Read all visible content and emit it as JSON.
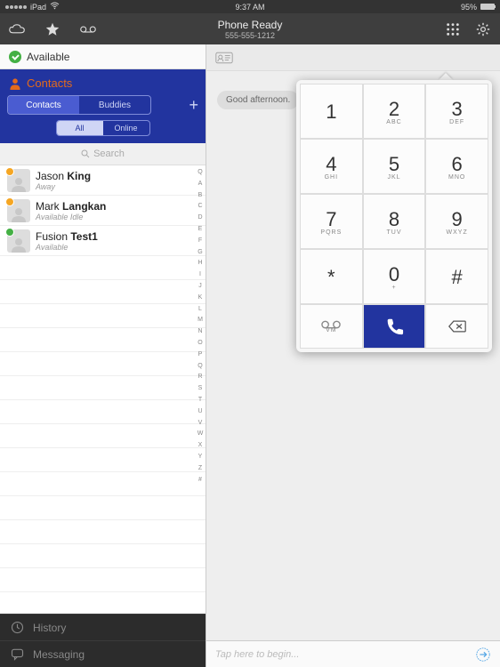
{
  "status": {
    "device": "iPad",
    "wifi": true,
    "time": "9:37 AM",
    "battery_pct": "95%"
  },
  "nav": {
    "title": "Phone Ready",
    "subtitle": "555-555-1212"
  },
  "presence": {
    "status_label": "Available"
  },
  "sidebar": {
    "section_title": "Contacts",
    "tabs_primary": {
      "a": "Contacts",
      "b": "Buddies",
      "active": "a"
    },
    "tabs_secondary": {
      "a": "All",
      "b": "Online",
      "active": "a"
    },
    "search_placeholder": "Search",
    "index": [
      "Q",
      "A",
      "B",
      "C",
      "D",
      "E",
      "F",
      "G",
      "H",
      "I",
      "J",
      "K",
      "L",
      "M",
      "N",
      "O",
      "P",
      "Q",
      "R",
      "S",
      "T",
      "U",
      "V",
      "W",
      "X",
      "Y",
      "Z",
      "#"
    ],
    "bottom": {
      "history": "History",
      "messaging": "Messaging"
    }
  },
  "contacts": [
    {
      "first": "Jason",
      "last": "King",
      "sub": "Away",
      "badge": "orange"
    },
    {
      "first": "Mark",
      "last": "Langkan",
      "sub": "Available Idle",
      "badge": "orange"
    },
    {
      "first": "Fusion",
      "last": "Test1",
      "sub": "Available",
      "badge": "green"
    }
  ],
  "chat": {
    "bubble_text": "Good afternoon.",
    "compose_placeholder": "Tap here to begin..."
  },
  "dialpad": {
    "keys": [
      {
        "d": "1",
        "l": ""
      },
      {
        "d": "2",
        "l": "ABC"
      },
      {
        "d": "3",
        "l": "DEF"
      },
      {
        "d": "4",
        "l": "GHI"
      },
      {
        "d": "5",
        "l": "JKL"
      },
      {
        "d": "6",
        "l": "MNO"
      },
      {
        "d": "7",
        "l": "PQRS"
      },
      {
        "d": "8",
        "l": "TUV"
      },
      {
        "d": "9",
        "l": "WXYZ"
      },
      {
        "d": "*",
        "l": ""
      },
      {
        "d": "0",
        "l": "+"
      },
      {
        "d": "#",
        "l": ""
      }
    ],
    "vm_label": "VM"
  }
}
